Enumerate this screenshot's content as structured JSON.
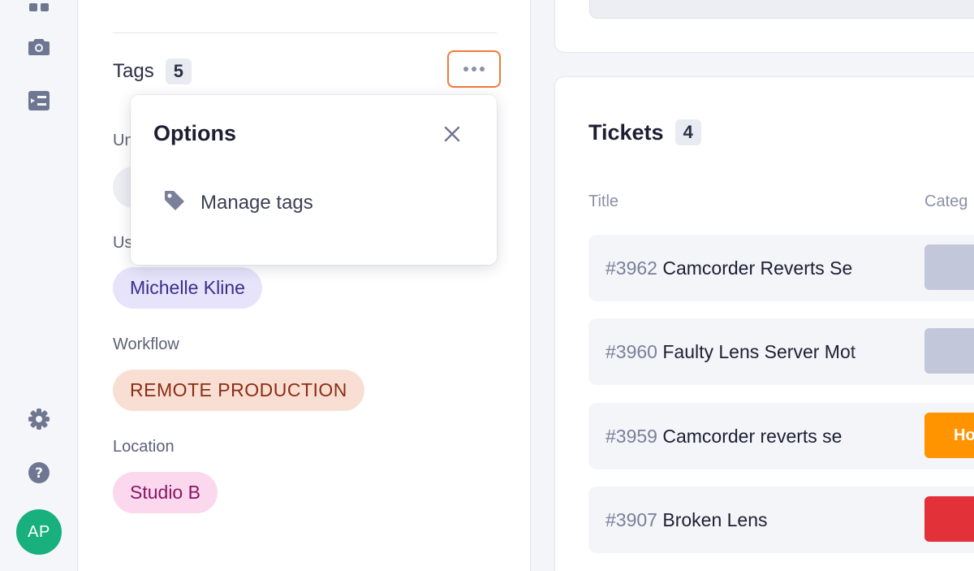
{
  "sidebar": {
    "avatar_initials": "AP"
  },
  "details": {
    "tags_title": "Tags",
    "tags_count": "5",
    "fields": [
      {
        "label": "Us",
        "value": "Michelle Kline"
      },
      {
        "label": "Workflow",
        "value": "REMOTE PRODUCTION"
      },
      {
        "label": "Location",
        "value": "Studio B"
      }
    ],
    "hidden_label": "Un"
  },
  "popover": {
    "title": "Options",
    "items": [
      {
        "label": "Manage tags",
        "icon": "tag-icon"
      }
    ]
  },
  "tickets": {
    "title": "Tickets",
    "count": "4",
    "columns": [
      "Title",
      "Categ"
    ],
    "rows": [
      {
        "number": "#3962",
        "title": "Camcorder Reverts Se",
        "category_label": "",
        "category_color": "#c3c7da"
      },
      {
        "number": "#3960",
        "title": "Faulty Lens Server Mot",
        "category_label": "",
        "category_color": "#c3c7da"
      },
      {
        "number": "#3959",
        "title": "Camcorder reverts se",
        "category_label": "Ho",
        "category_color": "#ff9300"
      },
      {
        "number": "#3907",
        "title": "Broken Lens",
        "category_label": "",
        "category_color": "#e3313a"
      }
    ]
  },
  "colors": {
    "accent_outline": "#f07a3a",
    "avatar_bg": "#18b07c"
  }
}
